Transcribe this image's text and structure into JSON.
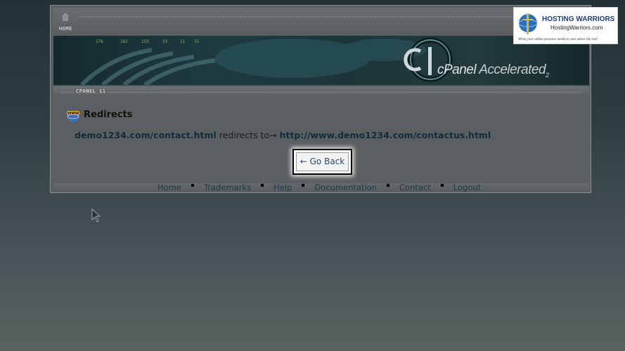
{
  "topbar": {
    "home_label": "HOME"
  },
  "banner": {
    "brand_c": "cPanel",
    "brand_accel": "Accelerated",
    "brand_ver": "2"
  },
  "version_bar": {
    "label": "CPANEL 11"
  },
  "content": {
    "title": "Redirects",
    "source": "demo1234.com/contact.html",
    "redirect_text": "redirects to→",
    "target": "http://www.demo1234.com/contactus.html",
    "go_back_label": "← Go Back"
  },
  "footer": {
    "links": [
      "Home",
      "Trademarks",
      "Help",
      "Documentation",
      "Contact",
      "Logout"
    ]
  },
  "logo": {
    "title": "HOSTING WARRIORS",
    "url": "HostingWarriors.com",
    "tagline": "When your online presence needs to your above the rest!"
  },
  "icons": {
    "home": "home-icon",
    "redirects": "www-globe-icon",
    "cursor": "mouse-pointer-icon"
  }
}
